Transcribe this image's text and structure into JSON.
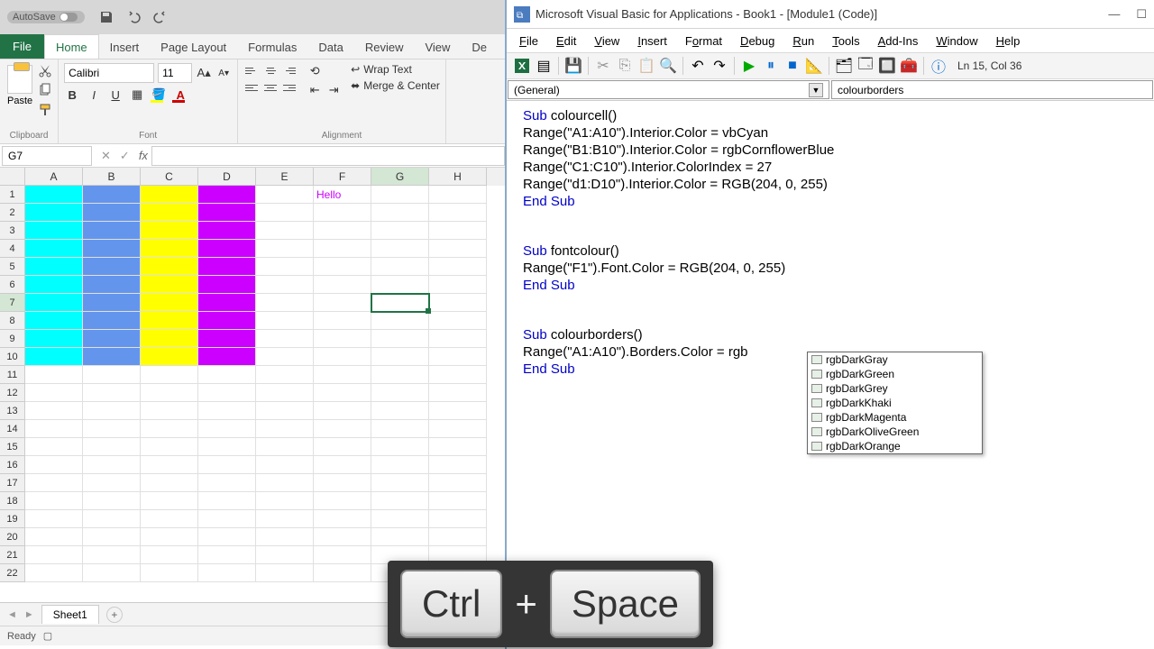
{
  "excel": {
    "autosave_label": "AutoSave",
    "tabs": {
      "file": "File",
      "home": "Home",
      "insert": "Insert",
      "page_layout": "Page Layout",
      "formulas": "Formulas",
      "data": "Data",
      "review": "Review",
      "view": "View",
      "dev": "De"
    },
    "clipboard": {
      "paste": "Paste",
      "label": "Clipboard"
    },
    "font": {
      "name": "Calibri",
      "size": "11",
      "label": "Font"
    },
    "alignment": {
      "wrap": "Wrap Text",
      "merge": "Merge & Center",
      "label": "Alignment"
    },
    "namebox": "G7",
    "cells": {
      "f1": "Hello"
    },
    "sheet": "Sheet1",
    "status": "Ready"
  },
  "vba": {
    "title": "Microsoft Visual Basic for Applications - Book1 - [Module1 (Code)]",
    "menu": {
      "file": "File",
      "edit": "Edit",
      "view": "View",
      "insert": "Insert",
      "format": "Format",
      "debug": "Debug",
      "run": "Run",
      "tools": "Tools",
      "addins": "Add-Ins",
      "window": "Window",
      "help": "Help"
    },
    "cursor": "Ln 15, Col 36",
    "dd_left": "(General)",
    "dd_right": "colourborders",
    "code": {
      "l1_a": "Sub",
      "l1_b": " colourcell()",
      "l2": "Range(\"A1:A10\").Interior.Color = vbCyan",
      "l3": "Range(\"B1:B10\").Interior.Color = rgbCornflowerBlue",
      "l4": "Range(\"C1:C10\").Interior.ColorIndex = 27",
      "l5": "Range(\"d1:D10\").Interior.Color = RGB(204, 0, 255)",
      "l6": "End Sub",
      "l8_a": "Sub",
      "l8_b": " fontcolour()",
      "l9": "Range(\"F1\").Font.Color = RGB(204, 0, 255)",
      "l10": "End Sub",
      "l12_a": "Sub",
      "l12_b": " colourborders()",
      "l13": "Range(\"A1:A10\").Borders.Color = rgb",
      "l14": "End Sub"
    },
    "intellisense": [
      "rgbDarkGray",
      "rgbDarkGreen",
      "rgbDarkGrey",
      "rgbDarkKhaki",
      "rgbDarkMagenta",
      "rgbDarkOliveGreen",
      "rgbDarkOrange"
    ]
  },
  "keys": {
    "ctrl": "Ctrl",
    "space": "Space"
  }
}
